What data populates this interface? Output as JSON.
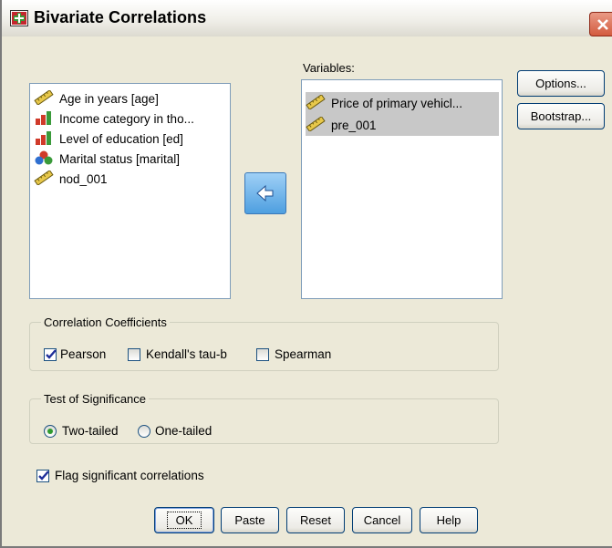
{
  "window": {
    "title": "Bivariate Correlations"
  },
  "source_list": {
    "items": [
      {
        "label": "Age in years [age]",
        "icon": "scale-ruler-icon"
      },
      {
        "label": "Income category in tho...",
        "icon": "ordinal-bars-icon"
      },
      {
        "label": "Level of education [ed]",
        "icon": "ordinal-bars-icon"
      },
      {
        "label": "Marital status [marital]",
        "icon": "nominal-circles-icon"
      },
      {
        "label": "nod_001",
        "icon": "scale-ruler-icon"
      }
    ]
  },
  "variables": {
    "label": "Variables:",
    "items": [
      {
        "label": "Price of primary vehicl...",
        "icon": "scale-ruler-icon"
      },
      {
        "label": "pre_001",
        "icon": "scale-ruler-icon"
      }
    ]
  },
  "side_buttons": {
    "options": "Options...",
    "bootstrap": "Bootstrap..."
  },
  "correlation": {
    "title": "Correlation Coefficients",
    "pearson": "Pearson",
    "kendall": "Kendall's tau-b",
    "spearman": "Spearman",
    "pearson_checked": true,
    "kendall_checked": false,
    "spearman_checked": false
  },
  "significance": {
    "title": "Test of Significance",
    "two_tailed": "Two-tailed",
    "one_tailed": "One-tailed",
    "selected": "two_tailed"
  },
  "flag": {
    "label": "Flag significant correlations",
    "checked": true
  },
  "buttons": {
    "ok": "OK",
    "paste": "Paste",
    "reset": "Reset",
    "cancel": "Cancel",
    "help": "Help"
  },
  "colors": {
    "window_bg": "#ece9d8",
    "selection": "#c8c8c8",
    "move_button": "#4e9fe0",
    "border": "#7f9db9"
  }
}
